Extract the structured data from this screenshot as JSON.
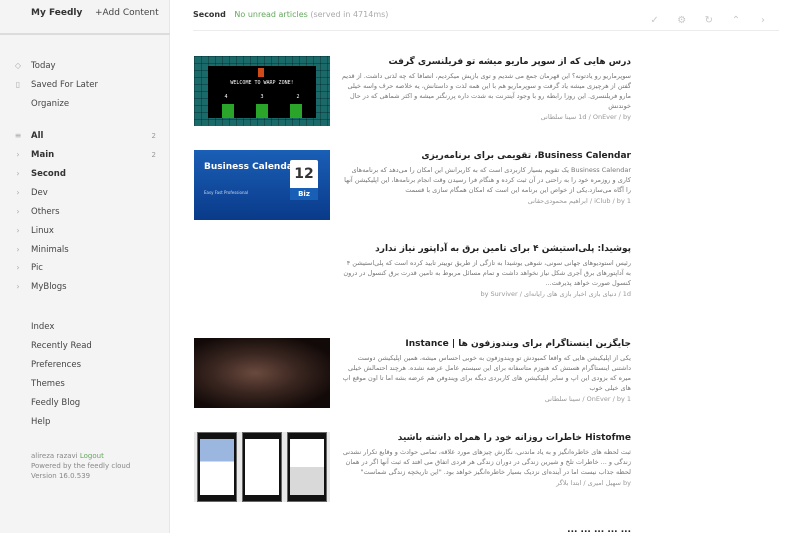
{
  "sidebar": {
    "tabs": {
      "my_feedly": "My Feedly",
      "add_content": "+Add Content"
    },
    "top_items": [
      {
        "label": "Today",
        "icon": "compass-icon"
      },
      {
        "label": "Saved For Later",
        "icon": "bookmark-icon"
      },
      {
        "label": "Organize",
        "icon": ""
      }
    ],
    "categories": [
      {
        "label": "All",
        "count": "2",
        "bold": true,
        "icon": "list-icon"
      },
      {
        "label": "Main",
        "count": "2",
        "bold": true,
        "icon": "chevron-right-icon"
      },
      {
        "label": "Second",
        "count": "",
        "bold": true,
        "icon": "chevron-right-icon"
      },
      {
        "label": "Dev",
        "count": "",
        "bold": false,
        "icon": "chevron-right-icon"
      },
      {
        "label": "Others",
        "count": "",
        "bold": false,
        "icon": "chevron-right-icon"
      },
      {
        "label": "Linux",
        "count": "",
        "bold": false,
        "icon": "chevron-right-icon"
      },
      {
        "label": "Minimals",
        "count": "",
        "bold": false,
        "icon": "chevron-right-icon"
      },
      {
        "label": "Pic",
        "count": "",
        "bold": false,
        "icon": "chevron-right-icon"
      },
      {
        "label": "MyBlogs",
        "count": "",
        "bold": false,
        "icon": "chevron-right-icon"
      }
    ],
    "bottom_items": [
      "Index",
      "Recently Read",
      "Preferences",
      "Themes",
      "Feedly Blog",
      "Help"
    ],
    "footer": {
      "user": "alireza razavi",
      "logout": "Logout",
      "powered": "Powered by the feedly cloud",
      "version": "Version 16.0.539"
    }
  },
  "main": {
    "title": "Second",
    "unread": "No unread articles",
    "served": "(served in 4714ms)",
    "toolbar_icons": [
      "check-icon",
      "gear-icon",
      "refresh-icon",
      "collapse-icon",
      "chevron-right-icon"
    ],
    "articles": [
      {
        "title": "درس هایی که از سوپر ماریو میشه تو فریلنسری گرفت",
        "summary": "سوپرماریو رو یادتونه؟ این قهرمان جمع می شدیم و توی بازیش میکردیم، انصافا که چه لذتی داشت. از قدیم گفتن از هرچیزی میشه یاد گرفت و سوپرماریو هم با این همه لذت و داستانش، یه خلاصه حرف واسه خیلی مارو فریلنسری. این روزا رابطه رو با وجود آینترنت به شدت داره پررنگتر میشه و اکثر شماهی که در حال خوندنش",
        "meta": "1d / OnEver / by سینا سلطانی"
      },
      {
        "title": "Business Calendar، تقویمی برای برنامه‌ریزی",
        "summary": "Business Calendar یک تقویم بسیار کاربردی است که به کاربرانش این امکان را می‌دهد که برنامه‌های کاری و روزمره خود را به راحتی در آن ثبت کرده و هنگام فرا رسیدن وقت انجام برنامه‌ها، این اپلیکیشن آنها را آگاه می‌سازد.یکی از خواص این برنامه این است که امکان همگام سازی با قسمت",
        "meta": "iClub / by 1 / ابراهیم محمودی‌حقانی"
      },
      {
        "title": "پوشیدا: پلی‌استیشن ۴ برای تامین برق به آداپتور نیاز ندارد",
        "summary": "رئیس استودیوهای جهانی سونی، شوهی یوشیدا به تازگی از طریق توییتر تایید کرده است که پلی‌استیشن ۴ به آداپتورهای برق آجری شکل نیاز نخواهد داشت و تمام مسائل مربوط به تامین قدرت برق کنسول در درون کنسول صورت خواهد پذیرفت...",
        "meta": "1d / دنیای بازی اخبار بازی های رایانه‌ای / by Surviver"
      },
      {
        "title": "جایگزین اینستاگرام برای ویندوزفون ها | Instance",
        "summary": "یکی از اپلیکیشن هایی که واقعا کمبودش تو ویندوزفون به خوبی احساس میشه، همین اپلیکیشن دوست داشتنی اینستاگرام هستش که هنوزم متاسفانه برای این سیستم عامل عرضه نشده. هرچند احتمالش خیلی میره که بزودی این اپ و سایر اپلیکیشن های کاربردی دیگه برای ویندوفن هم عرضه بشه اما تا اون موقع اپ های خیلی خوب",
        "meta": "OnEver / by 1 / سینا سلطانی"
      },
      {
        "title": "Histofme خاطرات روزانه خود را همراه داشته باشید",
        "summary": "ثبت لحظه های خاطره‌انگیز و به یاد ماندنی، نگارش چیزهای مورد علاقه، تمامی حوادث و وقایع تکرار نشدنی زندگی و ... خاطرات تلخ و شیرین زندگی در دوران زندگی هر فردی اتفاق می افتد که ثبت آنها اگر در همان لحظه جذاب نیست اما در آینده‌ای نزدیک بسیار خاطره‌انگیز خواهد بود. \"این تاریخچه زندگی شماست\"",
        "meta": "by سهیل امیری / ابتدا بلاگر"
      },
      {
        "title": "... ... ... ... ...",
        "summary": "",
        "meta": ""
      }
    ]
  },
  "thumbs": {
    "mario": {
      "text": "WELCOME TO WARP ZONE!",
      "nums": [
        "4",
        "3",
        "2"
      ]
    },
    "calendar": {
      "title": "Business Calendar",
      "sub": "Easy Fast Professional",
      "day": "12",
      "biz": "Biz"
    }
  }
}
